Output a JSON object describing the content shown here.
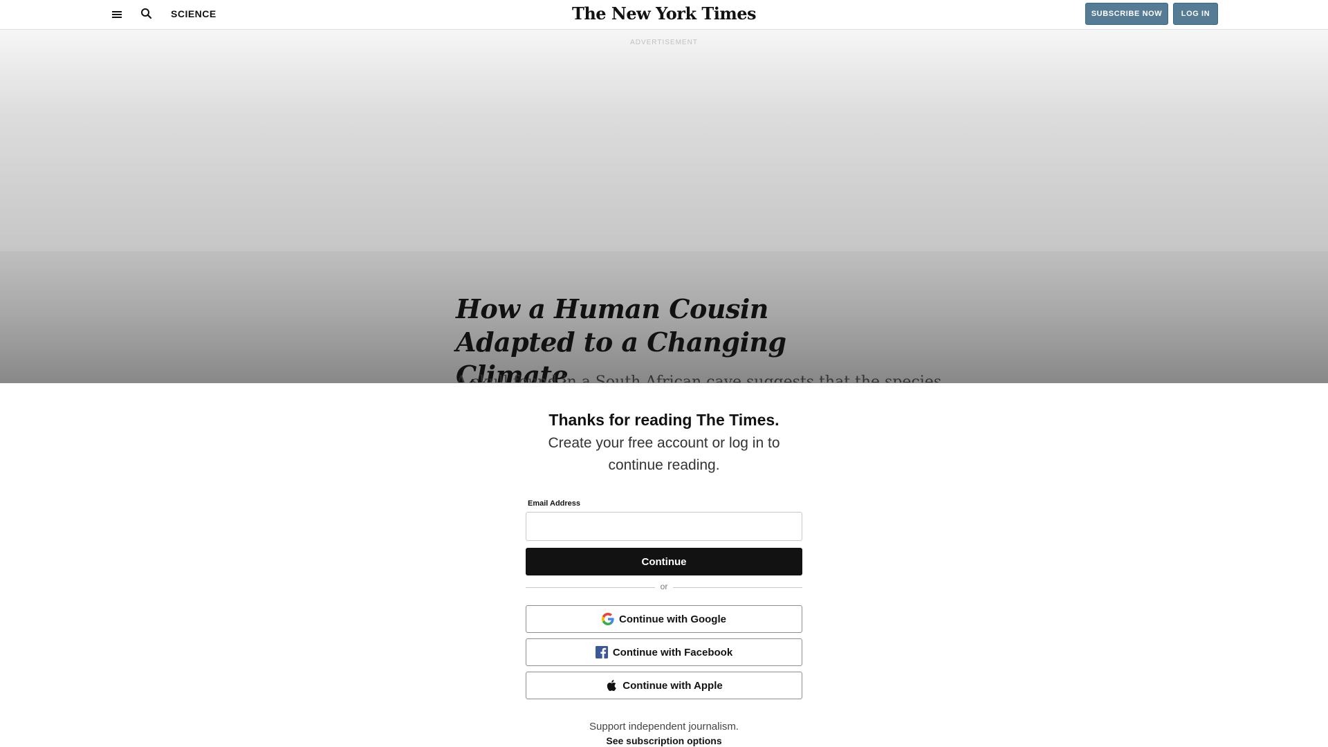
{
  "header": {
    "section": "SCIENCE",
    "logo": "The New York Times",
    "subscribe_label": "SUBSCRIBE NOW",
    "login_label": "LOG IN"
  },
  "ad": {
    "label": "ADVERTISEMENT"
  },
  "article": {
    "headline": "How a Human Cousin Adapted to a Changing Climate",
    "summary": "A skull found in a South African cave suggests that the species"
  },
  "modal": {
    "title": "Thanks for reading The Times.",
    "subtitle": "Create your free account or log in to continue reading.",
    "email_label": "Email Address",
    "email_value": "",
    "continue_label": "Continue",
    "or_label": "or",
    "google_label": "Continue with Google",
    "facebook_label": "Continue with Facebook",
    "apple_label": "Continue with Apple",
    "support_text": "Support independent journalism.",
    "subscription_link": "See subscription options"
  },
  "colors": {
    "subscribe_bg": "#567b95",
    "continue_bg": "#121212",
    "facebook_blue": "#3b5998"
  },
  "icons": [
    "hamburger-menu-icon",
    "search-icon",
    "google-icon",
    "facebook-icon",
    "apple-icon"
  ]
}
